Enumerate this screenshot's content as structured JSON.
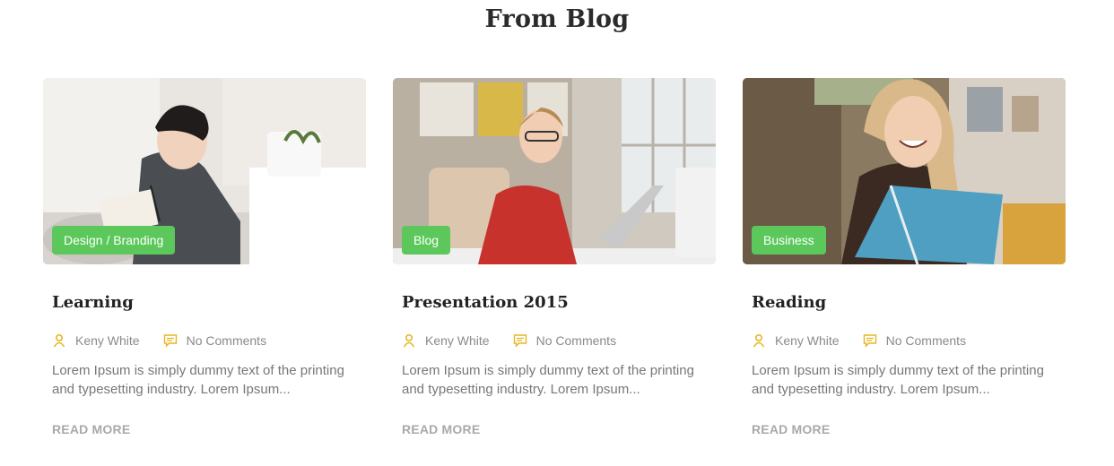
{
  "section": {
    "title": "From Blog"
  },
  "colors": {
    "tag_bg": "#5cc85c",
    "meta_icon": "#e9b521"
  },
  "posts": [
    {
      "category": "Design / Branding",
      "title": "Learning",
      "author": "Keny White",
      "comments": "No Comments",
      "excerpt": "Lorem Ipsum is simply dummy text of the printing and typesetting industry. Lorem Ipsum...",
      "read_more": "READ MORE"
    },
    {
      "category": "Blog",
      "title": "Presentation 2015",
      "author": "Keny White",
      "comments": "No Comments",
      "excerpt": "Lorem Ipsum is simply dummy text of the printing and typesetting industry. Lorem Ipsum...",
      "read_more": "READ MORE"
    },
    {
      "category": "Business",
      "title": "Reading",
      "author": "Keny White",
      "comments": "No Comments",
      "excerpt": "Lorem Ipsum is simply dummy text of the printing and typesetting industry. Lorem Ipsum...",
      "read_more": "READ MORE"
    }
  ]
}
